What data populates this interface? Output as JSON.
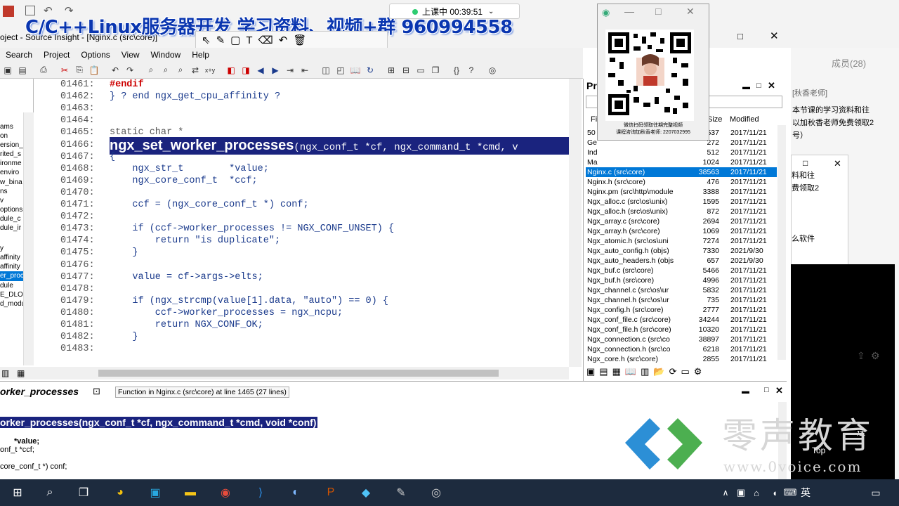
{
  "banner": {
    "text": "C/C++Linux服务器开发  学习资料、视频+群  960994558"
  },
  "window": {
    "title": "oject - Source Insight - [Nginx.c (src\\core)]"
  },
  "recording": {
    "status": "上课中 00:39:51"
  },
  "menu": [
    "Search",
    "Project",
    "Options",
    "View",
    "Window",
    "Help"
  ],
  "symbols": [
    {
      "label": "ams",
      "selected": false
    },
    {
      "label": "on",
      "selected": false
    },
    {
      "label": "ersion_ir",
      "selected": false
    },
    {
      "label": "rited_s",
      "selected": false
    },
    {
      "label": "ironme",
      "selected": false
    },
    {
      "label": "enviro",
      "selected": false
    },
    {
      "label": "w_bina",
      "selected": false
    },
    {
      "label": "ns",
      "selected": false
    },
    {
      "label": "v",
      "selected": false
    },
    {
      "label": "options",
      "selected": false
    },
    {
      "label": "dule_c",
      "selected": false
    },
    {
      "label": "dule_ir",
      "selected": false
    },
    {
      "label": "y",
      "selected": false
    },
    {
      "label": "affinity",
      "selected": false
    },
    {
      "label": "affinity",
      "selected": false
    },
    {
      "label": "er_proc",
      "selected": true
    },
    {
      "label": "dule",
      "selected": false
    },
    {
      "label": "E_DLO",
      "selected": false
    },
    {
      "label": "d_modu",
      "selected": false
    }
  ],
  "code": {
    "lines": [
      {
        "n": "01461:",
        "text": "#endif",
        "cls": "kw"
      },
      {
        "n": "01462:",
        "text": "} ? end ngx_get_cpu_affinity ?",
        "cls": "muted"
      },
      {
        "n": "01463:",
        "text": ""
      },
      {
        "n": "01464:",
        "text": ""
      },
      {
        "n": "01465:",
        "text": "static char *",
        "cls": "muted"
      },
      {
        "n": "01466:",
        "text": "ngx_set_worker_processes(ngx_conf_t *cf, ngx_command_t *cmd, v",
        "cls": "decl"
      },
      {
        "n": "01467:",
        "text": "{"
      },
      {
        "n": "01468:",
        "text": "    ngx_str_t        *value;"
      },
      {
        "n": "01469:",
        "text": "    ngx_core_conf_t  *ccf;"
      },
      {
        "n": "01470:",
        "text": ""
      },
      {
        "n": "01471:",
        "text": "    ccf = (ngx_core_conf_t *) conf;"
      },
      {
        "n": "01472:",
        "text": ""
      },
      {
        "n": "01473:",
        "text": "    if (ccf->worker_processes != NGX_CONF_UNSET) {"
      },
      {
        "n": "01474:",
        "text": "        return \"is duplicate\";"
      },
      {
        "n": "01475:",
        "text": "    }"
      },
      {
        "n": "01476:",
        "text": ""
      },
      {
        "n": "01477:",
        "text": "    value = cf->args->elts;"
      },
      {
        "n": "01478:",
        "text": ""
      },
      {
        "n": "01479:",
        "text": "    if (ngx_strcmp(value[1].data, \"auto\") == 0) {"
      },
      {
        "n": "01480:",
        "text": "        ccf->worker_processes = ngx_ncpu;"
      },
      {
        "n": "01481:",
        "text": "        return NGX_CONF_OK;"
      },
      {
        "n": "01482:",
        "text": "    }"
      },
      {
        "n": "01483:",
        "text": ""
      }
    ]
  },
  "project": {
    "header_title": "Pr",
    "col_file": "Fil",
    "col_size": "Size",
    "col_modified": "Modified",
    "files": [
      {
        "name": "50",
        "size": "537",
        "date": "2017/11/21",
        "sel": false
      },
      {
        "name": "Ge",
        "size": "272",
        "date": "2017/11/21",
        "sel": false
      },
      {
        "name": "Ind",
        "size": "512",
        "date": "2017/11/21",
        "sel": false
      },
      {
        "name": "Ma",
        "size": "1024",
        "date": "2017/11/21",
        "sel": false
      },
      {
        "name": "Nginx.c (src\\core)",
        "size": "38563",
        "date": "2017/11/21",
        "sel": true
      },
      {
        "name": "Nginx.h (src\\core)",
        "size": "476",
        "date": "2017/11/21",
        "sel": false
      },
      {
        "name": "Nginx.pm (src\\http\\module",
        "size": "3388",
        "date": "2017/11/21",
        "sel": false
      },
      {
        "name": "Ngx_alloc.c (src\\os\\unix)",
        "size": "1595",
        "date": "2017/11/21",
        "sel": false
      },
      {
        "name": "Ngx_alloc.h (src\\os\\unix)",
        "size": "872",
        "date": "2017/11/21",
        "sel": false
      },
      {
        "name": "Ngx_array.c (src\\core)",
        "size": "2694",
        "date": "2017/11/21",
        "sel": false
      },
      {
        "name": "Ngx_array.h (src\\core)",
        "size": "1069",
        "date": "2017/11/21",
        "sel": false
      },
      {
        "name": "Ngx_atomic.h (src\\os\\uni",
        "size": "7274",
        "date": "2017/11/21",
        "sel": false
      },
      {
        "name": "Ngx_auto_config.h (objs)",
        "size": "7330",
        "date": "2021/9/30",
        "sel": false
      },
      {
        "name": "Ngx_auto_headers.h (objs",
        "size": "657",
        "date": "2021/9/30",
        "sel": false
      },
      {
        "name": "Ngx_buf.c (src\\core)",
        "size": "5466",
        "date": "2017/11/21",
        "sel": false
      },
      {
        "name": "Ngx_buf.h (src\\core)",
        "size": "4996",
        "date": "2017/11/21",
        "sel": false
      },
      {
        "name": "Ngx_channel.c (src\\os\\ur",
        "size": "5832",
        "date": "2017/11/21",
        "sel": false
      },
      {
        "name": "Ngx_channel.h (src\\os\\ur",
        "size": "735",
        "date": "2017/11/21",
        "sel": false
      },
      {
        "name": "Ngx_config.h (src\\core)",
        "size": "2777",
        "date": "2017/11/21",
        "sel": false
      },
      {
        "name": "Ngx_conf_file.c (src\\core)",
        "size": "34244",
        "date": "2017/11/21",
        "sel": false
      },
      {
        "name": "Ngx_conf_file.h (src\\core)",
        "size": "10320",
        "date": "2017/11/21",
        "sel": false
      },
      {
        "name": "Ngx_connection.c (src\\co",
        "size": "38897",
        "date": "2017/11/21",
        "sel": false
      },
      {
        "name": "Ngx_connection.h (src\\co",
        "size": "6218",
        "date": "2017/11/21",
        "sel": false
      },
      {
        "name": "Ngx_core.h (src\\core)",
        "size": "2855",
        "date": "2017/11/21",
        "sel": false
      }
    ]
  },
  "context": {
    "symbol": "orker_processes",
    "info": "Function in Nginx.c (src\\core) at line 1465 (27 lines)",
    "decl": "orker_processes(ngx_conf_t *cf, ngx_command_t *cmd, void *conf)",
    "line1": "*value;",
    "line2": "onf_t  *ccf;",
    "line3": "core_conf_t *) conf;"
  },
  "qr": {
    "caption1": "微信扫码领取往期完整视频",
    "caption2": "课程咨询加秋香老师: 2207032995"
  },
  "chat": {
    "members": "成员(28)",
    "teacher": "[秋香老师]",
    "msg1": "本节课的学习资料和往",
    "msg2": "以加秋香老师免费领取2",
    "msg3": "号）",
    "msg4": "料和往",
    "msg5": "费领取2",
    "msg6": "么软件",
    "send": "送",
    "top": "Top"
  },
  "watermark": {
    "text": "零声教育",
    "url": "www.0voice.com"
  },
  "taskbar": {
    "ime": "英"
  }
}
